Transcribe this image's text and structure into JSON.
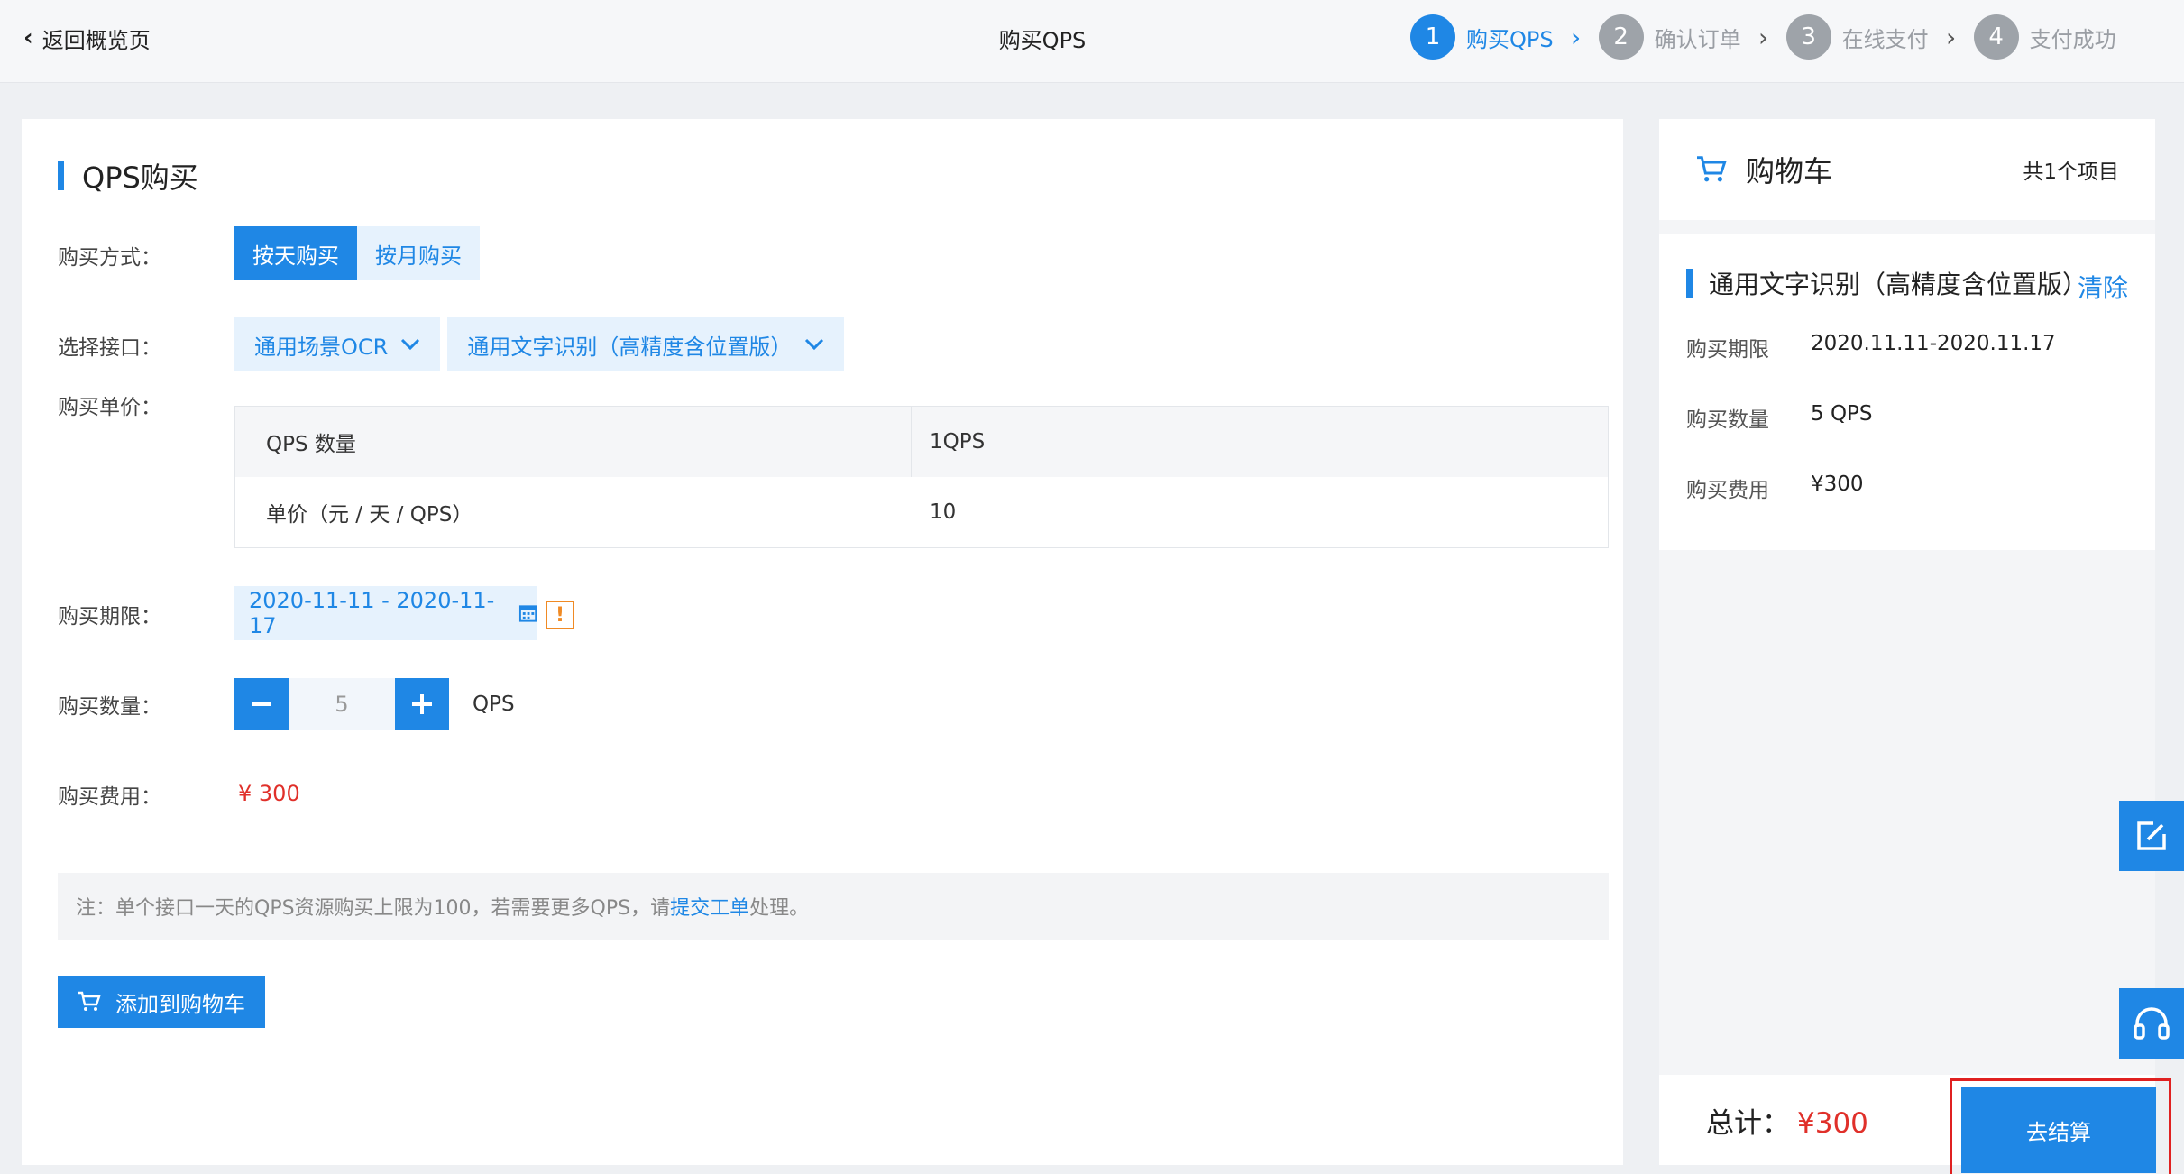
{
  "header": {
    "back_label": "返回概览页",
    "title": "购买QPS",
    "steps": [
      {
        "num": "1",
        "label": "购买QPS"
      },
      {
        "num": "2",
        "label": "确认订单"
      },
      {
        "num": "3",
        "label": "在线支付"
      },
      {
        "num": "4",
        "label": "支付成功"
      }
    ]
  },
  "form": {
    "section_title": "QPS购买",
    "labels": {
      "method": "购买方式：",
      "api": "选择接口：",
      "unit_price": "购买单价：",
      "period": "购买期限：",
      "quantity": "购买数量：",
      "fee": "购买费用："
    },
    "methods": [
      "按天购买",
      "按月购买"
    ],
    "api_category": "通用场景OCR",
    "api_name": "通用文字识别（高精度含位置版）",
    "price_table": {
      "head": [
        "QPS 数量",
        "1QPS"
      ],
      "row": [
        "单价（元 / 天 / QPS）",
        "10"
      ]
    },
    "date_range": "2020-11-11 - 2020-11-17",
    "warn_mark": "!",
    "quantity": "5",
    "quantity_unit": "QPS",
    "fee": "¥ 300",
    "note_prefix": "注：单个接口一天的QPS资源购买上限为100，若需要更多QPS，请",
    "note_link": "提交工单",
    "note_suffix": "处理。",
    "add_to_cart": "添加到购物车"
  },
  "cart": {
    "title": "购物车",
    "count": "共1个项目",
    "item": {
      "name": "通用文字识别（高精度含位置版）",
      "clear": "清除",
      "period_label": "购买期限",
      "period_value": "2020.11.11-2020.11.17",
      "quantity_label": "购买数量",
      "quantity_value": "5 QPS",
      "fee_label": "购买费用",
      "fee_value": "¥300"
    },
    "total_label": "总计：",
    "total_value": "¥300",
    "checkout": "去结算"
  },
  "icons": {
    "cart": "cart-icon",
    "calendar": "calendar-icon",
    "edit": "edit-icon",
    "headset": "headset-icon"
  },
  "colors": {
    "accent": "#1f87e5",
    "price": "#e0302a",
    "warning": "#f08a24",
    "highlight": "#e02020"
  }
}
